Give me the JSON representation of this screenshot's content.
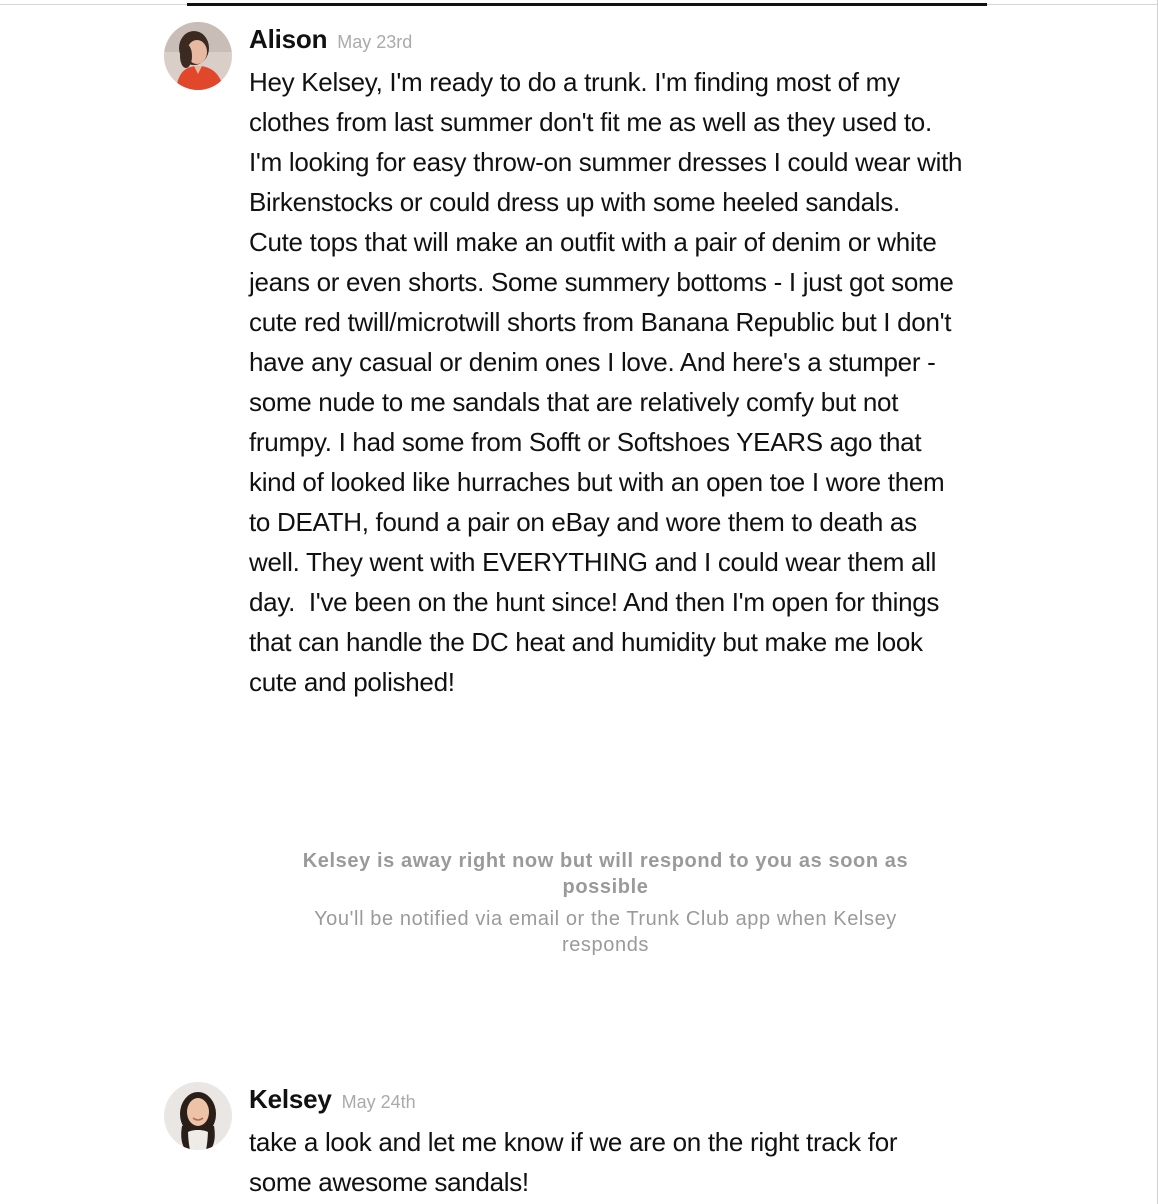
{
  "colors": {
    "accent_line": "#111111",
    "muted_text": "#9a9a9a",
    "date_text": "#aaaaaa"
  },
  "messages": [
    {
      "sender": "Alison",
      "date": "May 23rd",
      "avatar_icon": "avatar-alison",
      "body": "Hey Kelsey, I'm ready to do a trunk. I'm finding most of my clothes from last summer don't fit me as well as they used to. I'm looking for easy throw-on summer dresses I could wear with Birkenstocks or could dress up with some heeled sandals.  Cute tops that will make an outfit with a pair of denim or white jeans or even shorts. Some summery bottoms - I just got some cute red twill/microtwill shorts from Banana Republic but I don't have any casual or denim ones I love. And here's a stumper - some nude to me sandals that are relatively comfy but not frumpy. I had some from Sofft or Softshoes YEARS ago that kind of looked like hurraches but with an open toe I wore them to DEATH, found a pair on eBay and wore them to death as well. They went with EVERYTHING and I could wear them all day.  I've been on the hunt since! And then I'm open for things that can handle the DC heat and humidity but make me look cute and polished!"
    },
    {
      "sender": "Kelsey",
      "date": "May 24th",
      "avatar_icon": "avatar-kelsey",
      "body": "take a look and let me know if we are on the right track for some awesome sandals!"
    }
  ],
  "away_notice": {
    "title": "Kelsey is away right now but will respond to you as soon as possible",
    "subtitle": "You'll be notified via email or the Trunk Club app when Kelsey responds"
  }
}
